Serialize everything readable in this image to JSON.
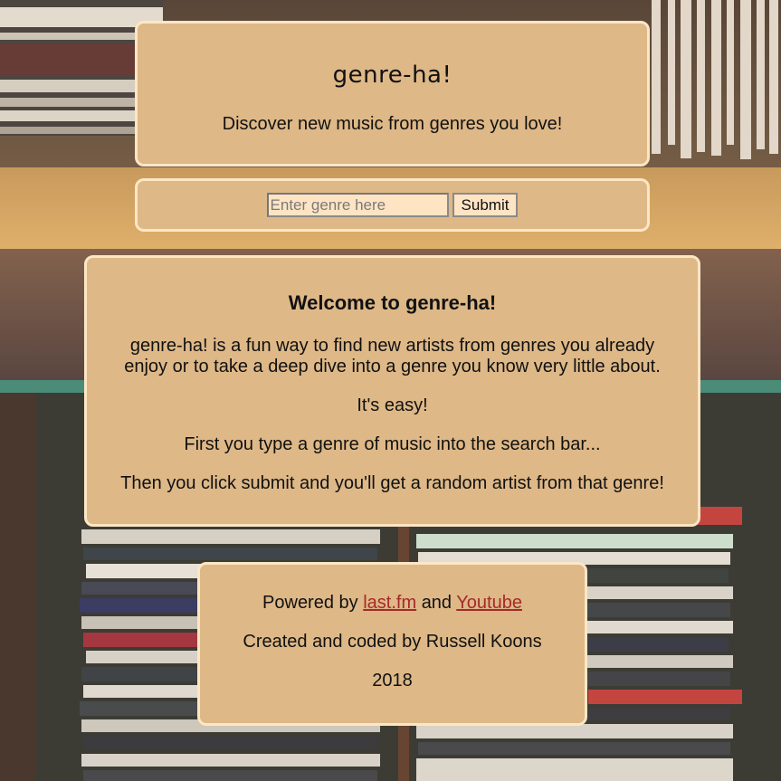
{
  "header": {
    "title": "genre-ha!",
    "tagline": "Discover new music from genres you love!"
  },
  "search": {
    "placeholder": "Enter genre here",
    "value": "",
    "submit_label": "Submit"
  },
  "welcome": {
    "heading": "Welcome to genre-ha!",
    "paragraphs": [
      "genre-ha! is a fun way to find new artists from genres you already enjoy or to take a deep dive into a genre you know very little about.",
      "It's easy!",
      "First you type a genre of music into the search bar...",
      "Then you click submit and you'll get a random artist from that genre!"
    ]
  },
  "footer": {
    "powered_prefix": "Powered by",
    "link_lastfm": "last.fm",
    "and_text": "and",
    "link_youtube": "Youtube",
    "credits": "Created and coded by Russell Koons",
    "year": "2018"
  },
  "colors": {
    "panel_bg": "#deb887",
    "panel_border": "#fde6c4",
    "link": "#a52a2a",
    "input_bg": "#ffe4c4"
  }
}
